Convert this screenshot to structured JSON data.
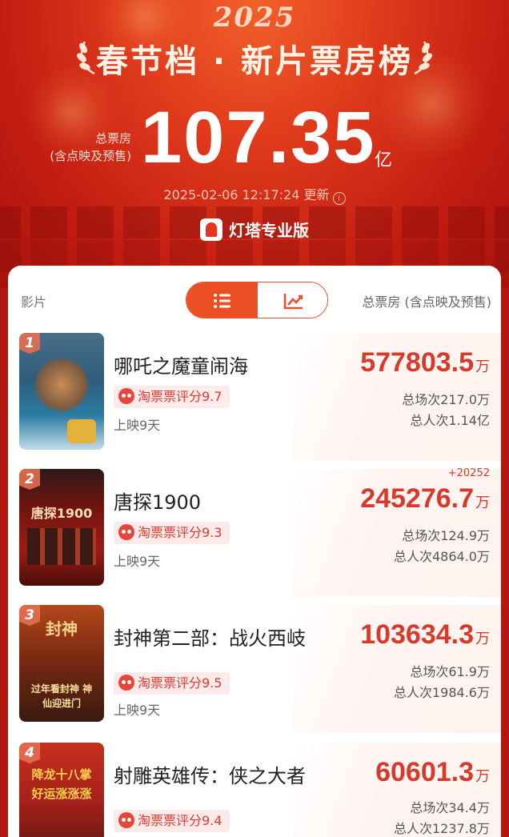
{
  "hero": {
    "year": "2025",
    "title": "春节档 · 新片票房榜",
    "total_label_line1": "总票房",
    "total_label_line2": "(含点映及预售)",
    "total_value": "107.35",
    "total_unit": "亿",
    "update_text": "2025-02-06 12:17:24 更新",
    "brand": "灯塔专业版"
  },
  "panel": {
    "col_left": "影片",
    "col_right": "总票房 (含点映及预售)",
    "toggle": {
      "active": "list-icon",
      "inactive": "trend-icon"
    }
  },
  "movies": [
    {
      "rank": "1",
      "title": "哪吒之魔童闹海",
      "rating": "淘票票评分9.7",
      "days": "上映9天",
      "box_value": "577803.5",
      "box_unit": "万",
      "delta": "",
      "shows": "总场次217.0万",
      "admissions": "总人次1.14亿",
      "poster_color": "#3d6f8f"
    },
    {
      "rank": "2",
      "title": "唐探1900",
      "rating": "淘票票评分9.3",
      "days": "上映9天",
      "box_value": "245276.7",
      "box_unit": "万",
      "delta": "+20252",
      "shows": "总场次124.9万",
      "admissions": "总人次4864.0万",
      "poster_color": "#8e1a15",
      "poster_text": "唐探1900"
    },
    {
      "rank": "3",
      "title": "封神第二部：战火西岐",
      "rating": "淘票票评分9.5",
      "days": "上映9天",
      "box_value": "103634.3",
      "box_unit": "万",
      "delta": "",
      "shows": "总场次61.9万",
      "admissions": "总人次1984.6万",
      "poster_color": "#7a2a12",
      "poster_text": "封神",
      "poster_caption": "过年看封神 神仙迎进门"
    },
    {
      "rank": "4",
      "title": "射雕英雄传：侠之大者",
      "rating": "淘票票评分9.4",
      "days": "",
      "box_value": "60601.3",
      "box_unit": "万",
      "delta": "",
      "shows": "总场次34.4万",
      "admissions": "总人次1237.8万",
      "poster_color": "#b3261a",
      "poster_text": "降龙十八掌 好运涨涨涨"
    }
  ]
}
